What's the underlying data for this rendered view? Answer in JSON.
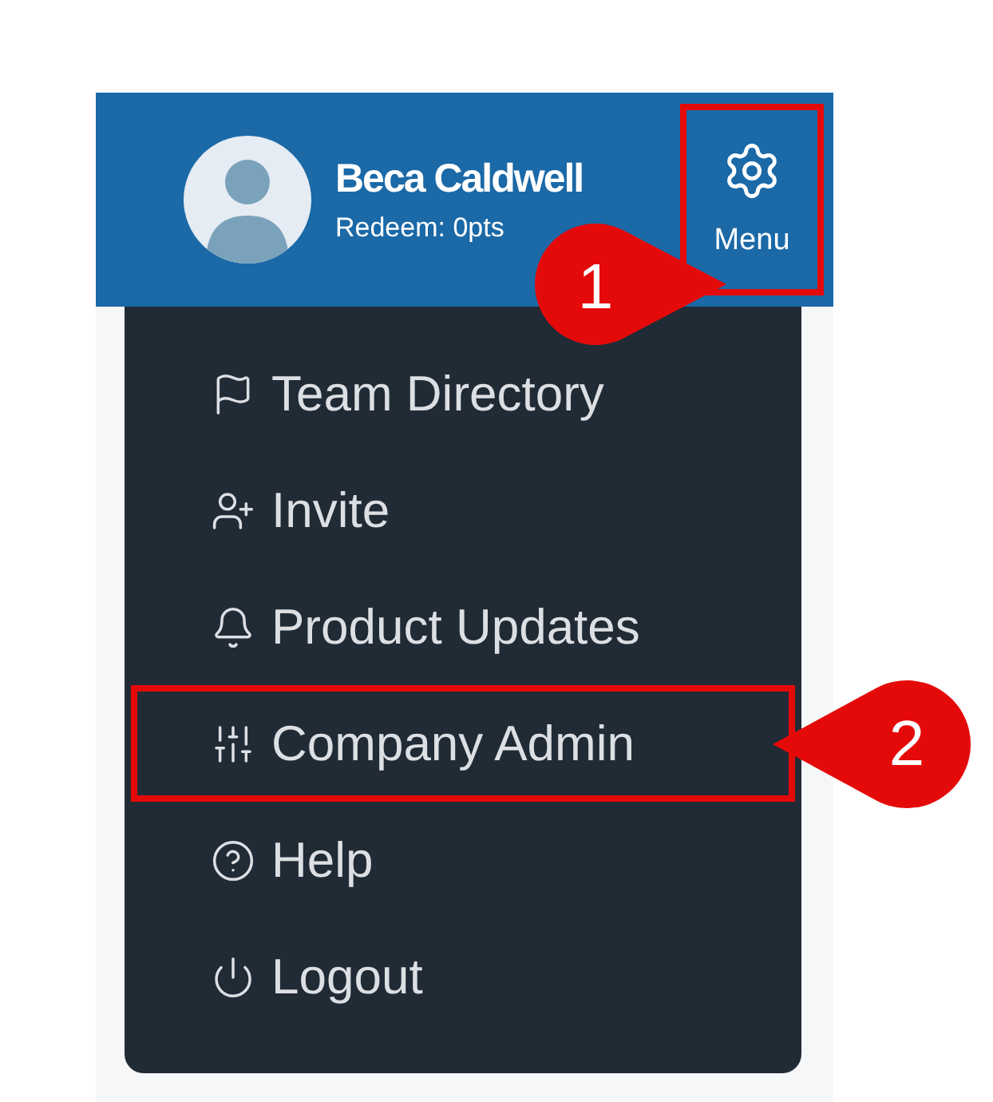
{
  "user": {
    "name": "Beca Caldwell",
    "points": "Redeem: 0pts"
  },
  "menu_button": {
    "label": "Menu",
    "highlighted": true
  },
  "menu_items": [
    {
      "label": "Team Directory",
      "highlighted": false
    },
    {
      "label": "Invite",
      "highlighted": false
    },
    {
      "label": "Product Updates",
      "highlighted": false
    },
    {
      "label": "Company Admin",
      "highlighted": true
    },
    {
      "label": "Help",
      "highlighted": false
    },
    {
      "label": "Logout",
      "highlighted": false
    }
  ],
  "callouts": [
    {
      "number": "1",
      "kind": "rightward"
    },
    {
      "number": "2",
      "kind": "leftward"
    }
  ]
}
